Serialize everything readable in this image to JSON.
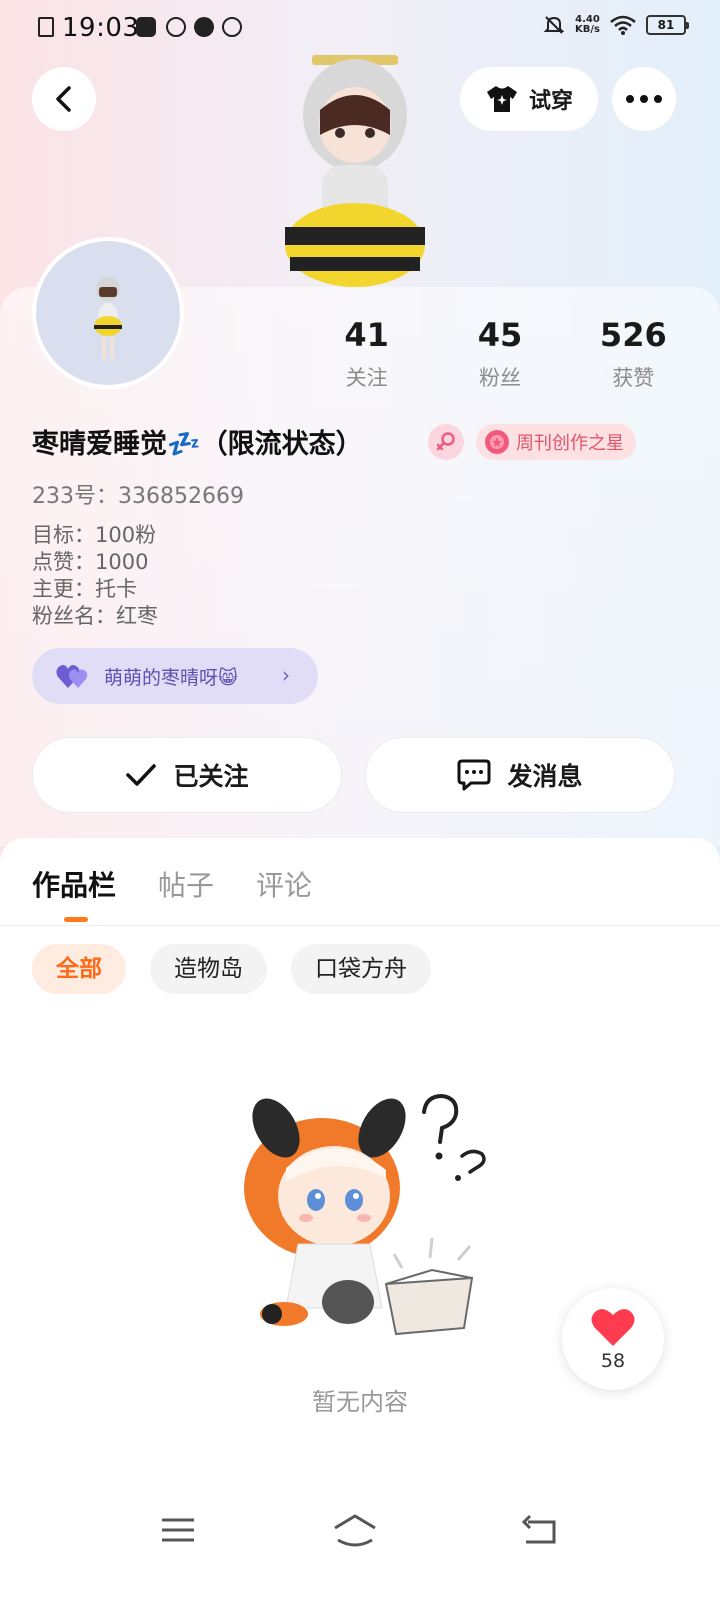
{
  "status_bar": {
    "time": "19:03",
    "net_speed_value": "4.40",
    "net_speed_unit": "KB/s",
    "battery": "81"
  },
  "header": {
    "try_on_label": "试穿"
  },
  "stats": [
    {
      "value": "41",
      "label": "关注"
    },
    {
      "value": "45",
      "label": "粉丝"
    },
    {
      "value": "526",
      "label": "获赞"
    }
  ],
  "profile": {
    "nickname": "枣晴爱睡觉💤（限流状态）",
    "weekly_badge": "周刊创作之星",
    "uid": "233号：336852669",
    "bio": [
      "目标：100粉",
      "点赞：1000",
      "主更：托卡",
      "粉丝名：红枣"
    ],
    "group_name": "萌萌的枣晴呀😸"
  },
  "actions": {
    "followed_label": "已关注",
    "message_label": "发消息"
  },
  "tabs": [
    "作品栏",
    "帖子",
    "评论"
  ],
  "filters": [
    "全部",
    "造物岛",
    "口袋方舟"
  ],
  "empty_text": "暂无内容",
  "like_count": "58",
  "colors": {
    "accent": "#ff7a1a",
    "heart": "#ff3b4f",
    "group_pill": "#e2ddf6"
  }
}
